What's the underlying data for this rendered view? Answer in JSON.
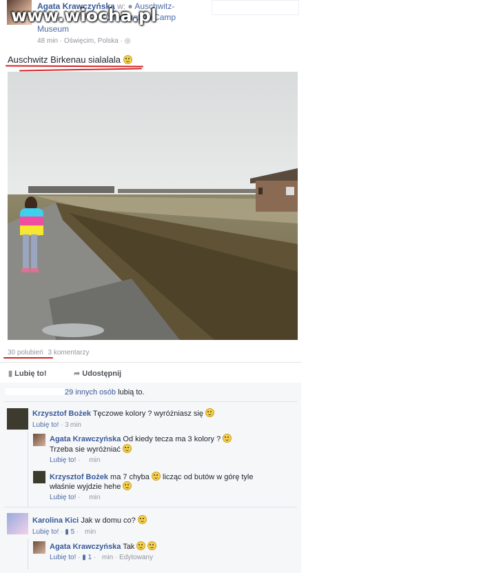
{
  "post": {
    "author": "Agata Krawczyńska",
    "location_prefix": "w:",
    "location_line1": "Auschwitz-",
    "location_line2": "Concentration Camp",
    "location_line3": "Museum",
    "watermark": "www.wiocha.pl",
    "meta_time": "48 min",
    "meta_place": "Oświęcim, Polska",
    "text": "Auschwitz Birkenau sialalala",
    "likes": "30 polubień",
    "comments_count": "3 komentarzy"
  },
  "actions": {
    "like": "Lubię to!",
    "share": "Udostępnij"
  },
  "likes_summary": {
    "others": "29 innych osób",
    "suffix": "lubią to."
  },
  "comments": [
    {
      "author": "Krzysztof Bożek",
      "text": "Tęczowe kolory ? wyróżniasz się",
      "like_label": "Lubię to!",
      "time": "min"
    },
    {
      "author": "Agata Krawczyńska",
      "text_line1": "Od kiedy tecza ma 3 kolory ?",
      "text_line2": "Trzeba sie wyróżniać",
      "like_label": "Lubię to!",
      "time": "min"
    },
    {
      "author": "Krzysztof Bożek",
      "text_line1": "ma 7 chyba",
      "text_line1b": "licząc od butów w górę tyle",
      "text_line2": "właśnie wyjdzie hehe",
      "like_label": "Lubię to!",
      "time": "min"
    },
    {
      "author": "Karolina Kici",
      "text": "Jak w domu co?",
      "like_label": "Lubię to!",
      "likes": "5",
      "time": "min"
    },
    {
      "author": "Agata Krawczyńska",
      "text": "Tak",
      "like_label": "Lubię to!",
      "likes": "1",
      "time": "min",
      "edited": "Edytowany"
    }
  ],
  "colors": {
    "link": "#365899",
    "underline": "#d42121",
    "comments_bg": "#f6f7f9"
  }
}
